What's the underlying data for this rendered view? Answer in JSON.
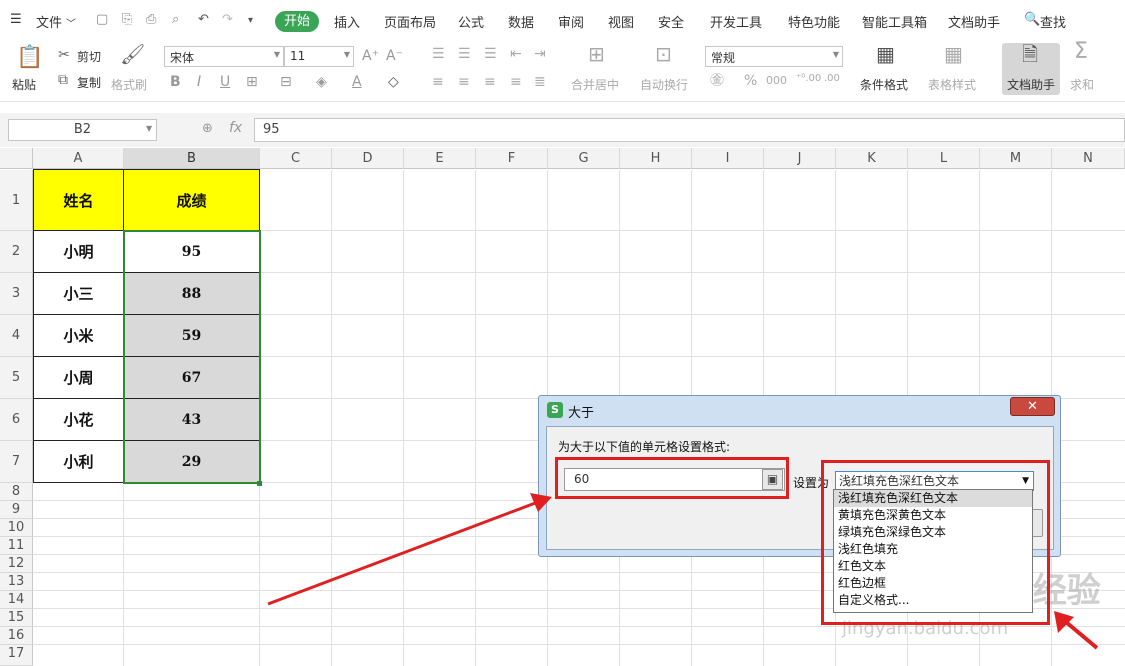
{
  "menu": {
    "file": "文件",
    "tabs": [
      "开始",
      "插入",
      "页面布局",
      "公式",
      "数据",
      "审阅",
      "视图",
      "安全",
      "开发工具",
      "特色功能",
      "智能工具箱",
      "文档助手"
    ],
    "search": "查找"
  },
  "ribbon": {
    "paste": "粘贴",
    "cut": "剪切",
    "copy": "复制",
    "format_painter": "格式刷",
    "font_name": "宋体",
    "font_size": "11",
    "bold": "B",
    "italic": "I",
    "underline": "U",
    "number_format": "常规",
    "merge_center": "合并居中",
    "wrap_text": "自动换行",
    "conditional_format": "条件格式",
    "table_style": "表格样式",
    "doc_assistant": "文档助手",
    "sum": "求和"
  },
  "formula_bar": {
    "name_box": "B2",
    "fx": "fx",
    "value": "95"
  },
  "columns": [
    "A",
    "B",
    "C",
    "D",
    "E",
    "F",
    "G",
    "H",
    "I",
    "J",
    "K",
    "L",
    "M",
    "N"
  ],
  "rows": [
    "1",
    "2",
    "3",
    "4",
    "5",
    "6",
    "7",
    "8",
    "9",
    "10",
    "11",
    "12",
    "13",
    "14",
    "15",
    "16",
    "17"
  ],
  "table": {
    "headers": [
      "姓名",
      "成绩"
    ],
    "names": [
      "小明",
      "小三",
      "小米",
      "小周",
      "小花",
      "小利"
    ],
    "scores": [
      "95",
      "88",
      "59",
      "67",
      "43",
      "29"
    ]
  },
  "dialog": {
    "title": "大于",
    "prompt": "为大于以下值的单元格设置格式:",
    "value": "60",
    "set_as_label": "设置为",
    "selected": "浅红填充色深红色文本",
    "options": [
      "浅红填充色深红色文本",
      "黄填充色深黄色文本",
      "绿填充色深绿色文本",
      "浅红色填充",
      "红色文本",
      "红色边框",
      "自定义格式..."
    ]
  },
  "watermark": {
    "brand": "Bai du 经验",
    "url": "jingyan.baidu.com"
  },
  "colors": {
    "header_fill": "#ffff00",
    "selection_fill": "#d9d9d9",
    "selection_border": "#2e8b35",
    "annotation_red": "#e02020",
    "active_tab": "#3aa655"
  }
}
